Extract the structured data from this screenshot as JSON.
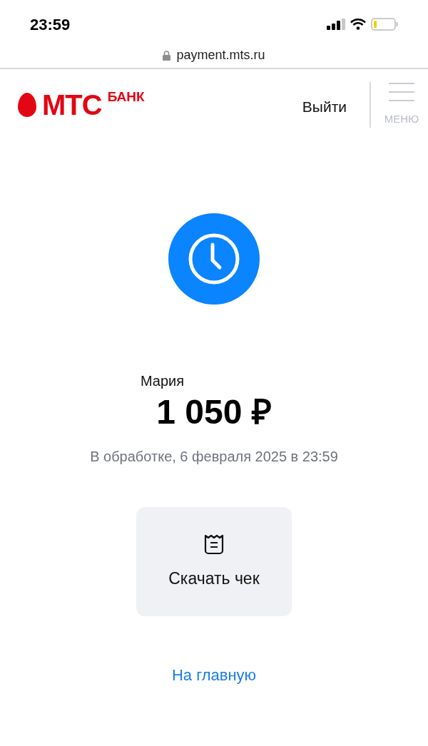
{
  "status_bar": {
    "time": "23:59"
  },
  "address_bar": {
    "url": "payment.mts.ru"
  },
  "header": {
    "logo": {
      "brand": "МТС",
      "suffix": "БАНК"
    },
    "logout": "Выйти",
    "menu_label": "МЕНЮ"
  },
  "payment": {
    "recipient": "Мария",
    "amount": "1 050 ₽",
    "status": "В обработке, 6 февраля 2025 в 23:59"
  },
  "receipt_button": "Скачать чек",
  "home_link": "На главную"
}
